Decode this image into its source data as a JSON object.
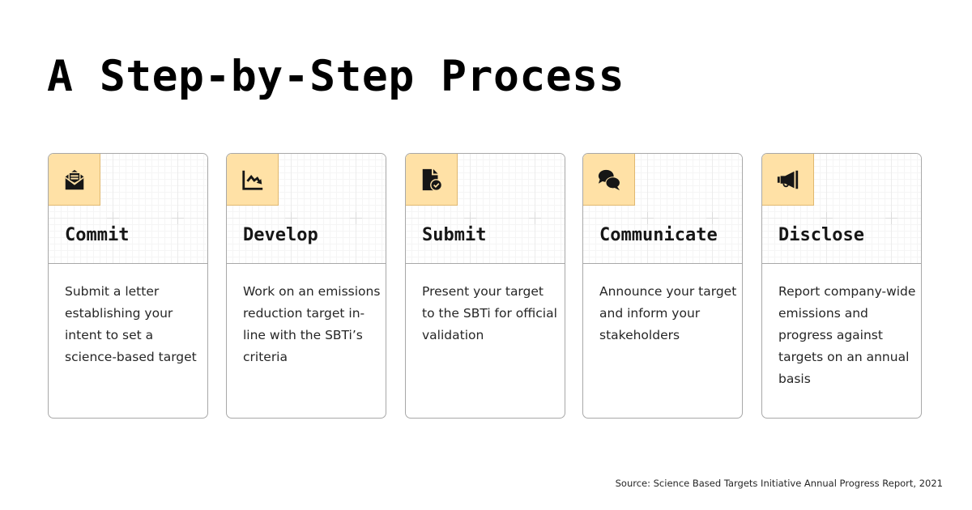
{
  "title": "A Step-by-Step Process",
  "colors": {
    "icon_box": "#ffe1a6",
    "border": "#a8a8a8",
    "text": "#161616"
  },
  "steps": [
    {
      "icon": "envelope-open-letter-icon",
      "title": "Commit",
      "description": "Submit a letter establishing your intent to set a science-based target"
    },
    {
      "icon": "chart-trending-down-icon",
      "title": "Develop",
      "description": "Work on an emissions reduction target in-line with the SBTi’s criteria"
    },
    {
      "icon": "document-check-icon",
      "title": "Submit",
      "description": "Present your target to the SBTi for official validation"
    },
    {
      "icon": "chat-bubbles-icon",
      "title": "Communicate",
      "description": "Announce your target and inform your stakeholders"
    },
    {
      "icon": "megaphone-icon",
      "title": "Disclose",
      "description": "Report company-wide emissions and progress against targets on an annual basis"
    }
  ],
  "source": "Source: Science Based Targets Initiative Annual Progress Report, 2021"
}
